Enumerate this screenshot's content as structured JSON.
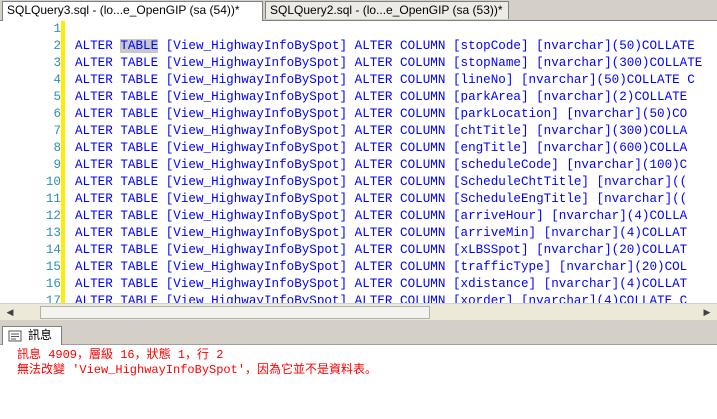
{
  "tabs": [
    {
      "label": "SQLQuery3.sql - (lo...e_OpenGIP (sa (54))*",
      "active": true
    },
    {
      "label": "SQLQuery2.sql - (lo...e_OpenGIP (sa (53))*",
      "active": false
    }
  ],
  "editor": {
    "lines": [
      {
        "num": "1",
        "text": ""
      },
      {
        "num": "2",
        "kw1": "ALTER",
        "kw2": "TABLE",
        "obj": "[View_HighwayInfoBySpot]",
        "kw3": "ALTER",
        "kw4": "COLUMN",
        "rest": "[stopCode] [nvarchar](50)COLLATE"
      },
      {
        "num": "3",
        "kw1": "ALTER",
        "kw2": "TABLE",
        "obj": "[View_HighwayInfoBySpot]",
        "kw3": "ALTER",
        "kw4": "COLUMN",
        "rest": "[stopName] [nvarchar](300)COLLATE"
      },
      {
        "num": "4",
        "kw1": "ALTER",
        "kw2": "TABLE",
        "obj": "[View_HighwayInfoBySpot]",
        "kw3": "ALTER",
        "kw4": "COLUMN",
        "rest": "[lineNo] [nvarchar](50)COLLATE C"
      },
      {
        "num": "5",
        "kw1": "ALTER",
        "kw2": "TABLE",
        "obj": "[View_HighwayInfoBySpot]",
        "kw3": "ALTER",
        "kw4": "COLUMN",
        "rest": "[parkArea] [nvarchar](2)COLLATE"
      },
      {
        "num": "6",
        "kw1": "ALTER",
        "kw2": "TABLE",
        "obj": "[View_HighwayInfoBySpot]",
        "kw3": "ALTER",
        "kw4": "COLUMN",
        "rest": "[parkLocation] [nvarchar](50)CO"
      },
      {
        "num": "7",
        "kw1": "ALTER",
        "kw2": "TABLE",
        "obj": "[View_HighwayInfoBySpot]",
        "kw3": "ALTER",
        "kw4": "COLUMN",
        "rest": "[chtTitle] [nvarchar](300)COLLA"
      },
      {
        "num": "8",
        "kw1": "ALTER",
        "kw2": "TABLE",
        "obj": "[View_HighwayInfoBySpot]",
        "kw3": "ALTER",
        "kw4": "COLUMN",
        "rest": "[engTitle] [nvarchar](600)COLLA"
      },
      {
        "num": "9",
        "kw1": "ALTER",
        "kw2": "TABLE",
        "obj": "[View_HighwayInfoBySpot]",
        "kw3": "ALTER",
        "kw4": "COLUMN",
        "rest": "[scheduleCode] [nvarchar](100)C"
      },
      {
        "num": "10",
        "kw1": "ALTER",
        "kw2": "TABLE",
        "obj": "[View_HighwayInfoBySpot]",
        "kw3": "ALTER",
        "kw4": "COLUMN",
        "rest": "[ScheduleChtTitle] [nvarchar](("
      },
      {
        "num": "11",
        "kw1": "ALTER",
        "kw2": "TABLE",
        "obj": "[View_HighwayInfoBySpot]",
        "kw3": "ALTER",
        "kw4": "COLUMN",
        "rest": "[ScheduleEngTitle] [nvarchar](("
      },
      {
        "num": "12",
        "kw1": "ALTER",
        "kw2": "TABLE",
        "obj": "[View_HighwayInfoBySpot]",
        "kw3": "ALTER",
        "kw4": "COLUMN",
        "rest": "[arriveHour] [nvarchar](4)COLLA"
      },
      {
        "num": "13",
        "kw1": "ALTER",
        "kw2": "TABLE",
        "obj": "[View_HighwayInfoBySpot]",
        "kw3": "ALTER",
        "kw4": "COLUMN",
        "rest": "[arriveMin] [nvarchar](4)COLLAT"
      },
      {
        "num": "14",
        "kw1": "ALTER",
        "kw2": "TABLE",
        "obj": "[View_HighwayInfoBySpot]",
        "kw3": "ALTER",
        "kw4": "COLUMN",
        "rest": "[xLBSSpot] [nvarchar](20)COLLAT"
      },
      {
        "num": "15",
        "kw1": "ALTER",
        "kw2": "TABLE",
        "obj": "[View_HighwayInfoBySpot]",
        "kw3": "ALTER",
        "kw4": "COLUMN",
        "rest": "[trafficType] [nvarchar](20)COL"
      },
      {
        "num": "16",
        "kw1": "ALTER",
        "kw2": "TABLE",
        "obj": "[View_HighwayInfoBySpot]",
        "kw3": "ALTER",
        "kw4": "COLUMN",
        "rest": "[xdistance] [nvarchar](4)COLLAT"
      },
      {
        "num": "17",
        "kw1": "ALTER",
        "kw2": "TABLE",
        "obj": "[View_HighwayInfoBySpot]",
        "kw3": "ALTER",
        "kw4": "COLUMN",
        "rest": "[xorder] [nvarchar](4)COLLATE C"
      }
    ]
  },
  "results": {
    "tab_label": "訊息",
    "messages": [
      "訊息 4909，層級 16，狀態 1，行 2",
      "無法改變 'View_HighwayInfoBySpot'，因為它並不是資料表。"
    ]
  },
  "colors": {
    "keyword": "#0000ff",
    "line_number": "#2b91af",
    "error": "#ff0000",
    "change_bar": "#ffec00"
  }
}
